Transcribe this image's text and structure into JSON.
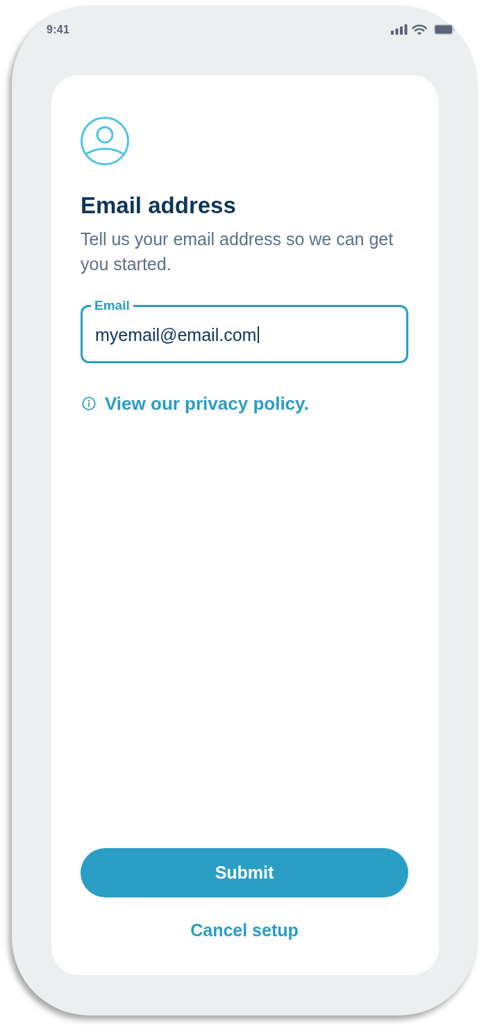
{
  "status_bar": {
    "time": "9:41"
  },
  "screen": {
    "title": "Email address",
    "description": "Tell us your email address so we can get you started.",
    "email_field": {
      "label": "Email",
      "value": "myemail@email.com",
      "focused": true
    },
    "privacy_link": "View our privacy policy."
  },
  "actions": [
    {
      "kind": "primary",
      "label": "Submit"
    },
    {
      "kind": "link",
      "label": "Cancel setup"
    }
  ]
}
